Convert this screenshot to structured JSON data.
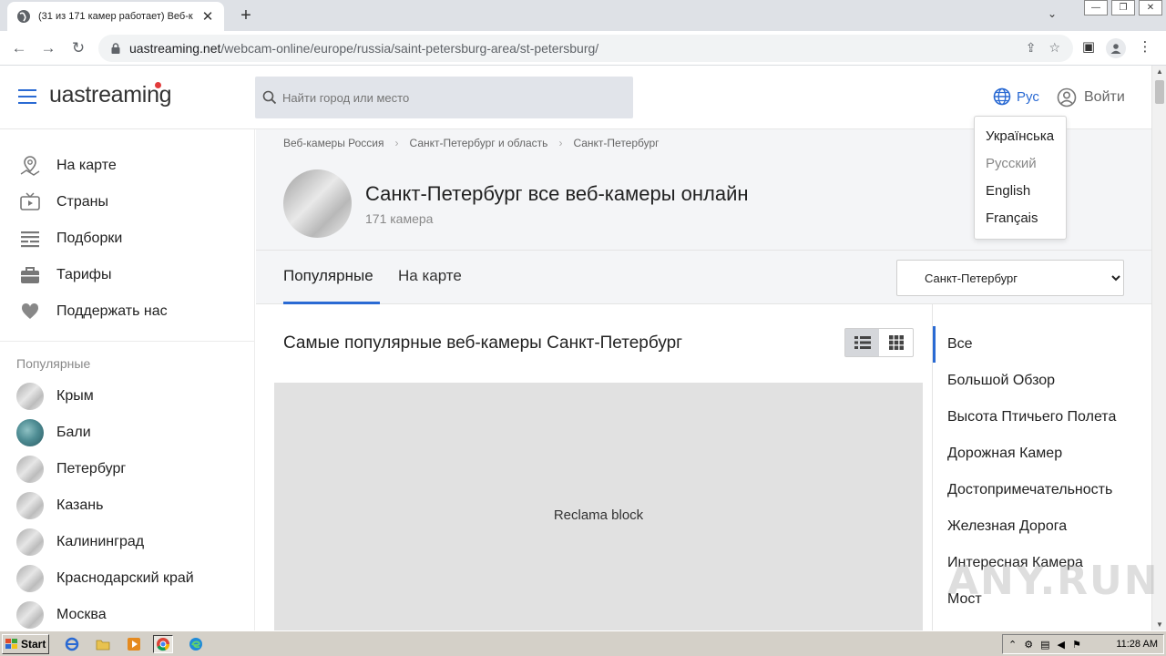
{
  "browser": {
    "tab_title": "(31 из 171 камер работает) Веб-к",
    "url_host": "uastreaming.net",
    "url_path": "/webcam-online/europe/russia/saint-petersburg-area/st-petersburg/"
  },
  "header": {
    "logo": "uastreaming",
    "search_placeholder": "Найти город или место",
    "lang_label": "Рус",
    "login_label": "Войти"
  },
  "lang_menu": [
    "Українська",
    "Русский",
    "English",
    "Français"
  ],
  "sidebar": {
    "nav": [
      {
        "label": "На карте",
        "icon": "map-pin-icon"
      },
      {
        "label": "Страны",
        "icon": "tv-icon"
      },
      {
        "label": "Подборки",
        "icon": "list-icon"
      },
      {
        "label": "Тарифы",
        "icon": "briefcase-icon"
      },
      {
        "label": "Поддержать нас",
        "icon": "heart-icon"
      }
    ],
    "popular_heading": "Популярные",
    "popular": [
      "Крым",
      "Бали",
      "Петербург",
      "Казань",
      "Калининград",
      "Краснодарский край",
      "Москва"
    ]
  },
  "breadcrumb": [
    "Веб-камеры Россия",
    "Санкт-Петербург и область",
    "Санкт-Петербург"
  ],
  "city": {
    "title": "Санкт-Петербург все веб-камеры онлайн",
    "count": "171 камера"
  },
  "tabs": {
    "popular": "Популярные",
    "map": "На карте",
    "select_value": "Санкт-Петербург"
  },
  "content": {
    "title": "Самые популярные веб-камеры Санкт-Петербург",
    "ad_label": "Reclama block"
  },
  "categories": [
    "Все",
    "Большой Обзор",
    "Высота Птичьего Полета",
    "Дорожная Камер",
    "Достопримечательность",
    "Железная Дорога",
    "Интересная Камера",
    "Мост"
  ],
  "watermark": "ANY.RUN",
  "taskbar": {
    "start_label": "Start",
    "clock": "11:28 AM"
  },
  "colors": {
    "accent": "#2a6ad3",
    "ad_bg": "#e1e1e1"
  }
}
